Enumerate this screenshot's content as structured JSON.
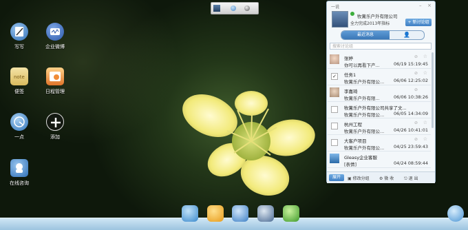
{
  "desktop": {
    "icons": [
      {
        "label": "写写",
        "icon": "pen-icon"
      },
      {
        "label": "企业微博",
        "icon": "weibo-icon"
      },
      {
        "label": "便签",
        "icon": "note-icon"
      },
      {
        "label": "日程管理",
        "icon": "calendar-icon"
      },
      {
        "label": "一点",
        "icon": "yidian-icon"
      },
      {
        "label": "添加",
        "icon": "add-icon"
      },
      {
        "label": "在线咨询",
        "icon": "chat-consult-icon"
      }
    ]
  },
  "panel": {
    "title": "一说",
    "company": "牧蓠乐户外有限公司",
    "signature": "全力完成2013年指标",
    "new_discussion": "新讨论组",
    "tabs": {
      "recent": "最近消息",
      "contacts": "👤"
    },
    "search_placeholder": "搜索讨论组",
    "conversations": [
      {
        "name": "张婷",
        "preview": "你可以再看下产...",
        "time": "06/19 15:19:45",
        "checked": false
      },
      {
        "name": "任务1",
        "preview": "牧蓠乐户外有限公...",
        "time": "06/06 12:25:02",
        "checked": true
      },
      {
        "name": "李嘉琦",
        "preview": "牧蓠乐户外有限...",
        "time": "06/06 10:38:26",
        "checked": false
      },
      {
        "name": "牧蓠乐户外有限公司共享了文...",
        "preview": "牧蓠乐户外有限公...",
        "time": "06/05 14:34:09",
        "checked": false
      },
      {
        "name": "杭州工程",
        "preview": "牧蓠乐户外有限公...",
        "time": "04/26 10:41:01",
        "checked": false
      },
      {
        "name": "大客户项目",
        "preview": "牧蓠乐户外有限公...",
        "time": "04/25 23:59:43",
        "checked": false
      },
      {
        "name": "Gleasy企业客服",
        "preview": "[表情]",
        "time": "04/24 08:59:44",
        "checked": false
      }
    ],
    "footer": {
      "expand": "展开",
      "edit_group": "修改分组",
      "settings": "微 收",
      "logout": "退 出"
    }
  },
  "colors": {
    "accent": "#3f7fc4",
    "dock": "#9cc4df"
  }
}
